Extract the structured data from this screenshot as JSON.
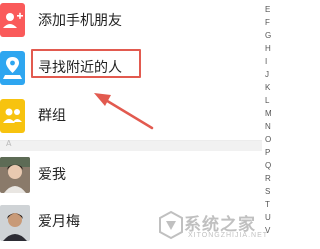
{
  "menu": {
    "add_friends": "添加手机朋友",
    "find_nearby": "寻找附近的人",
    "groups": "群组"
  },
  "section_letter": "A",
  "contacts": [
    {
      "name": "爱我"
    },
    {
      "name": "爱月梅"
    }
  ],
  "index_letters": [
    "E",
    "F",
    "G",
    "H",
    "I",
    "J",
    "K",
    "L",
    "M",
    "N",
    "O",
    "P",
    "Q",
    "R",
    "S",
    "T",
    "U",
    "V"
  ],
  "watermark": {
    "brand": "系统之家",
    "url": "XITONGZHIJIA.NET"
  },
  "colors": {
    "add_friends_icon": "#fa5a5a",
    "find_nearby_icon": "#2ea6f0",
    "groups_icon": "#f7c30f",
    "annotation": "#e25a4f"
  },
  "icons": {
    "add_friends": "add-contact-icon",
    "find_nearby": "location-pin-icon",
    "groups": "group-icon"
  }
}
